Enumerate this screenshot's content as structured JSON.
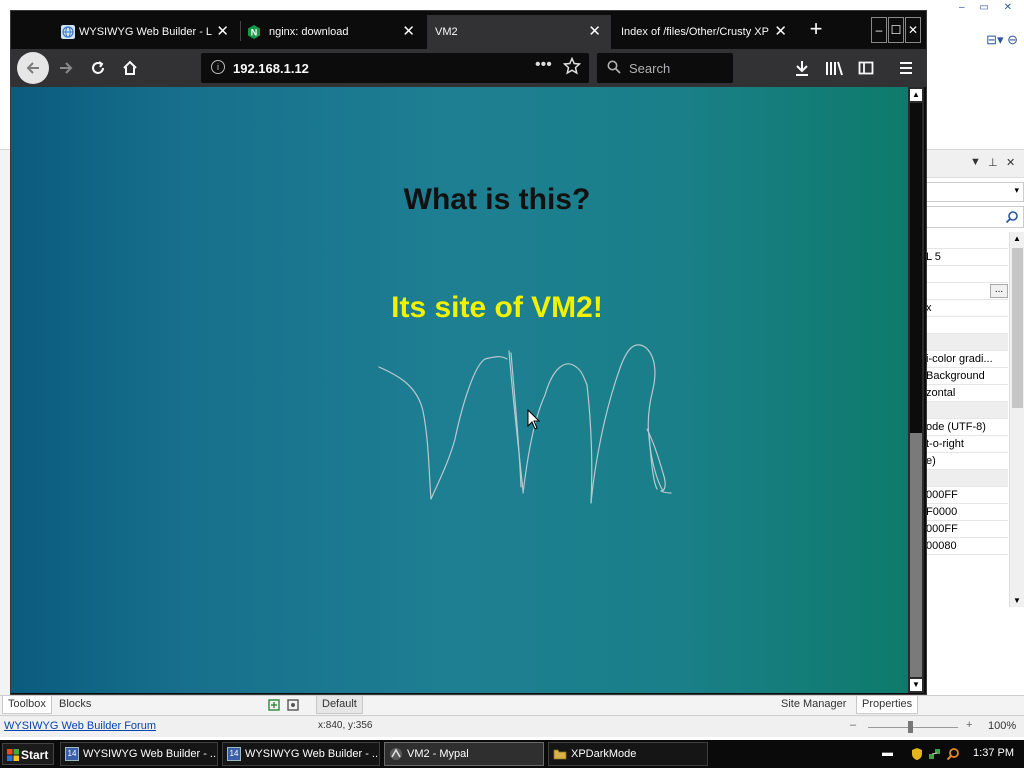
{
  "browser": {
    "tabs": [
      {
        "title": "WYSIWYG Web Builder - L",
        "favicon": "globe-icon",
        "active": false
      },
      {
        "title": "nginx: download",
        "favicon": "nginx-icon",
        "active": false
      },
      {
        "title": "VM2",
        "favicon": "",
        "active": true
      },
      {
        "title": "Index of /files/Other/Crusty XP",
        "favicon": "",
        "active": false
      }
    ],
    "new_tab_label": "+",
    "window_buttons": {
      "minimize": "–",
      "maximize": "☐",
      "close": "✕"
    },
    "tab_close_glyph": "✕",
    "address": "192.168.1.12",
    "search_placeholder": "Search",
    "colors": {
      "chrome": "#0c0c0d",
      "toolbar": "#323234"
    }
  },
  "page": {
    "heading": "What is this?",
    "subheading": "Its site of VM2!",
    "heading_color": "#111111",
    "subheading_color": "#f2f200"
  },
  "background_app": {
    "properties": [
      {
        "text": "",
        "category": false
      },
      {
        "text": "L 5",
        "category": false
      },
      {
        "text": "",
        "category": false
      },
      {
        "text": "",
        "category": false
      },
      {
        "text": "x",
        "category": false
      },
      {
        "text": "",
        "category": false
      },
      {
        "text": "",
        "category": true
      },
      {
        "text": "i-color gradi...",
        "category": false
      },
      {
        "text": " Background",
        "category": false
      },
      {
        "text": "zontal",
        "category": false
      },
      {
        "text": "",
        "category": true
      },
      {
        "text": "ode (UTF-8)",
        "category": false
      },
      {
        "text": "t-o-right",
        "category": false
      },
      {
        "text": "e)",
        "category": false
      },
      {
        "text": "",
        "category": true
      },
      {
        "text": "000FF",
        "category": false
      },
      {
        "text": "F0000",
        "category": false
      },
      {
        "text": "000FF",
        "category": false
      },
      {
        "text": "00080",
        "category": false
      }
    ],
    "dots_button": "...",
    "bottom_tabs": {
      "toolbox": "Toolbox",
      "blocks": "Blocks",
      "default": "Default",
      "site_manager": "Site Manager",
      "properties": "Properties"
    },
    "status": {
      "forum_link": "WYSIWYG Web Builder Forum",
      "coords": "x:840, y:356",
      "zoom": "100%",
      "zoom_minus": "–",
      "zoom_plus": "+"
    }
  },
  "taskbar": {
    "start_label": "Start",
    "tasks": [
      {
        "label": "WYSIWYG Web Builder - ...",
        "icon": "14",
        "active": false
      },
      {
        "label": "WYSIWYG Web Builder - ...",
        "icon": "14",
        "active": false
      },
      {
        "label": "VM2 - Mypal",
        "icon": "mypal-icon",
        "active": true
      },
      {
        "label": "XPDarkMode",
        "icon": "folder-icon",
        "active": false
      }
    ],
    "clock": "1:37 PM"
  }
}
